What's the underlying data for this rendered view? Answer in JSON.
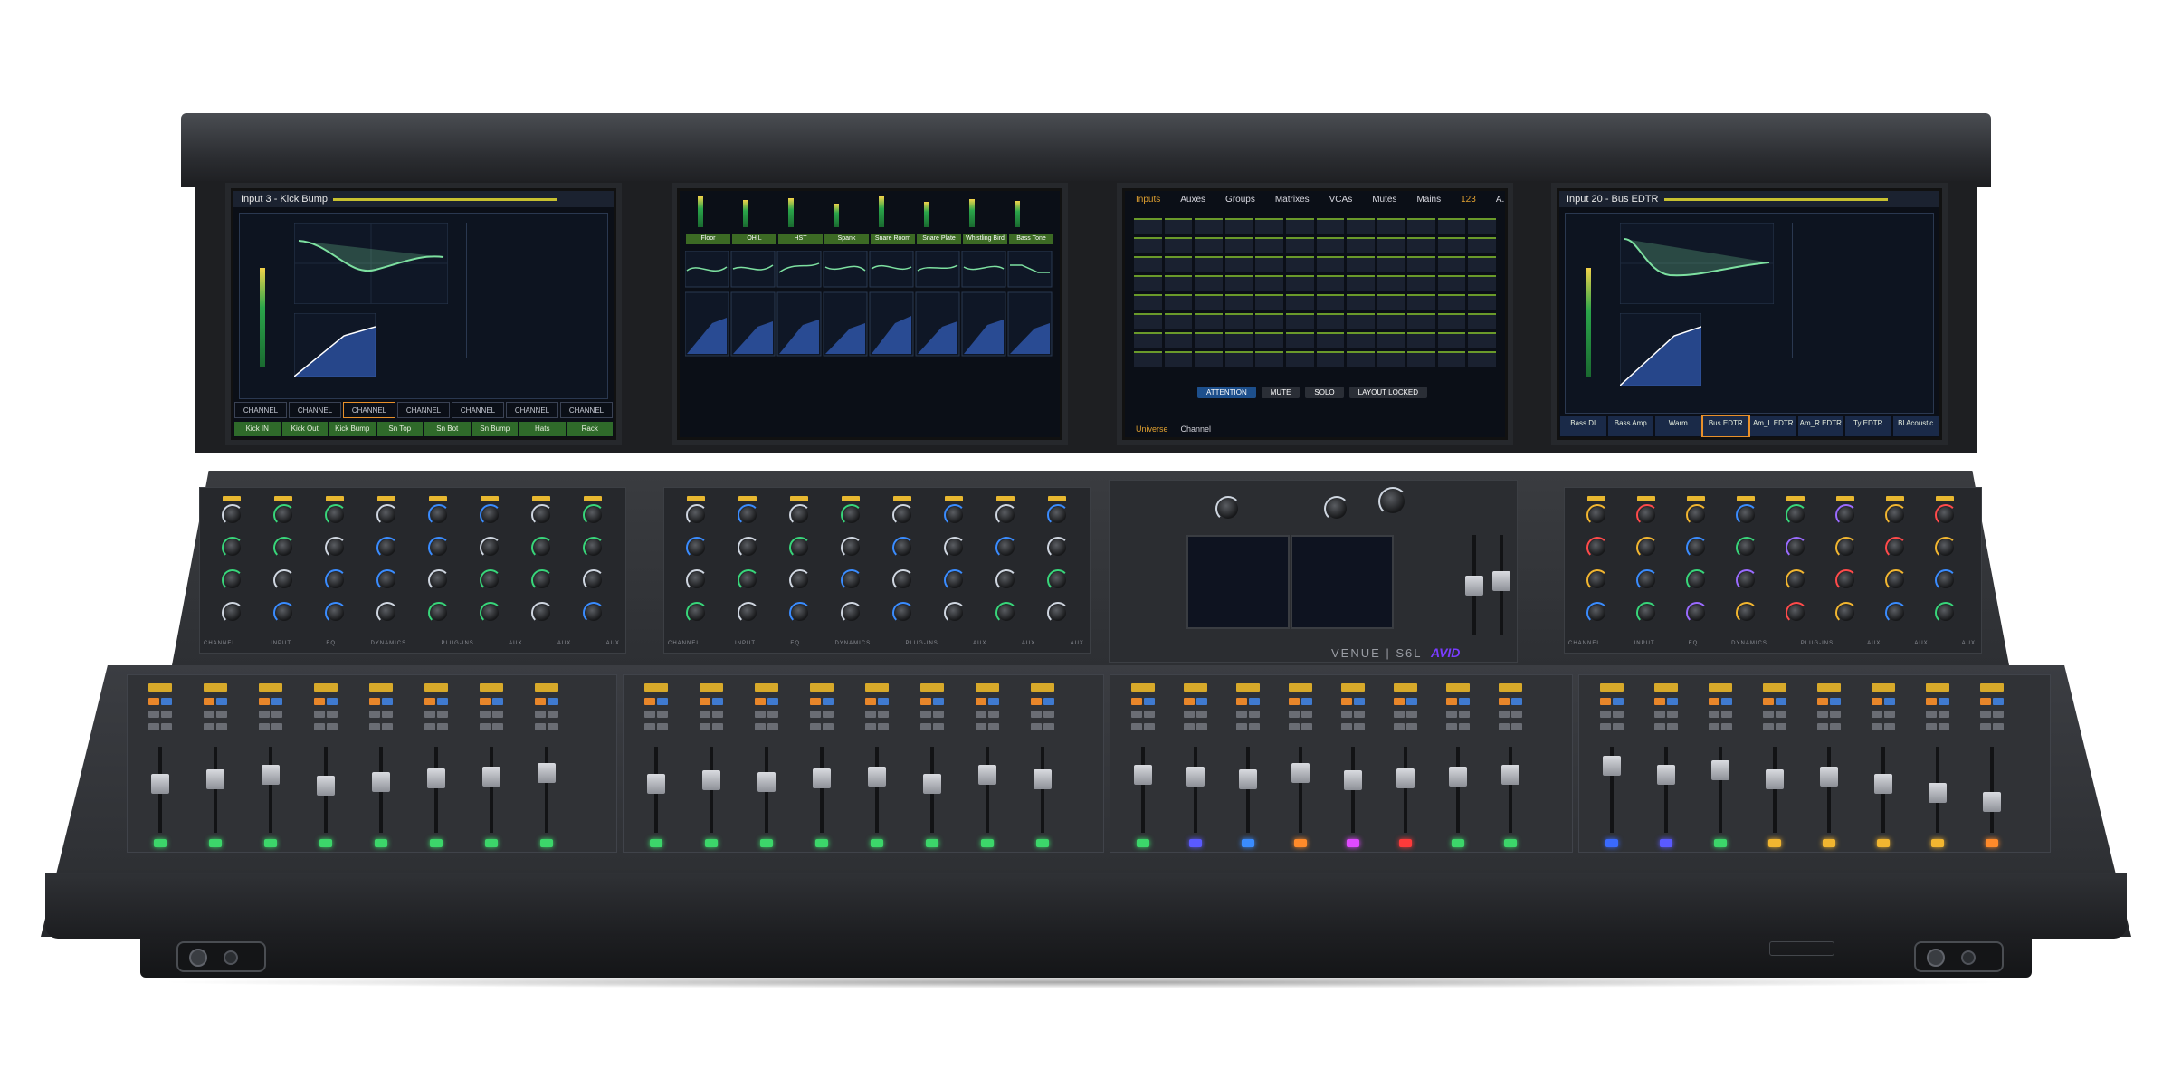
{
  "product": {
    "brand_label": "VENUE | S6L",
    "maker_logo": "AVID"
  },
  "screens": [
    {
      "title": "Input 3 - Kick Bump",
      "tabs": [
        "CHANNEL",
        "CHANNEL",
        "CHANNEL",
        "CHANNEL",
        "CHANNEL",
        "CHANNEL",
        "CHANNEL"
      ],
      "selected_tab": 2,
      "footer": [
        "Kick IN",
        "Kick Out",
        "Kick Bump",
        "Sn Top",
        "Sn Bot",
        "Sn Bump",
        "Hats",
        "Rack"
      ]
    },
    {
      "title": "",
      "strips": [
        "Floor",
        "OH L",
        "HST",
        "Spank",
        "Snare Room",
        "Snare Plate",
        "Whistling Bird",
        "Bass Tone"
      ]
    },
    {
      "nav": [
        "Inputs",
        "Auxes",
        "Groups",
        "Matrixes",
        "VCAs",
        "Mutes",
        "Mains",
        "123",
        "A..Z"
      ],
      "highlighted_nav": "123",
      "buttons": [
        "ATTENTION",
        "MUTE",
        "SOLO",
        "LAYOUT LOCKED"
      ],
      "footer_left": "Universe",
      "footer_right": "Channel"
    },
    {
      "title": "Input 20 - Bus EDTR",
      "footer": [
        "Bass DI",
        "Bass Amp",
        "Warm",
        "Bus EDTR",
        "Am_L EDTR",
        "Am_R EDTR",
        "Ty EDTR",
        "Bl Acoustic"
      ]
    }
  ],
  "section_labels": {
    "left": [
      "CHANNEL",
      "INPUT",
      "EQ",
      "DYNAMICS",
      "PLUG-INS",
      "AUX",
      "AUX",
      "AUX"
    ],
    "mid": [
      "CHANNEL",
      "INPUT",
      "EQ",
      "DYNAMICS",
      "PLUG-INS",
      "AUX",
      "AUX",
      "AUX"
    ],
    "right": [
      "CHANNEL",
      "INPUT",
      "EQ",
      "DYNAMICS",
      "PLUG-INS",
      "AUX",
      "AUX",
      "AUX"
    ]
  },
  "colors": {
    "chassis": "#2d2f33",
    "screen_bg": "#0b0f17",
    "accent_green": "#38d67a",
    "accent_blue": "#3a8cff",
    "accent_yellow": "#f2b630",
    "accent_orange": "#e8902a",
    "avid_purple": "#7a3cff"
  }
}
